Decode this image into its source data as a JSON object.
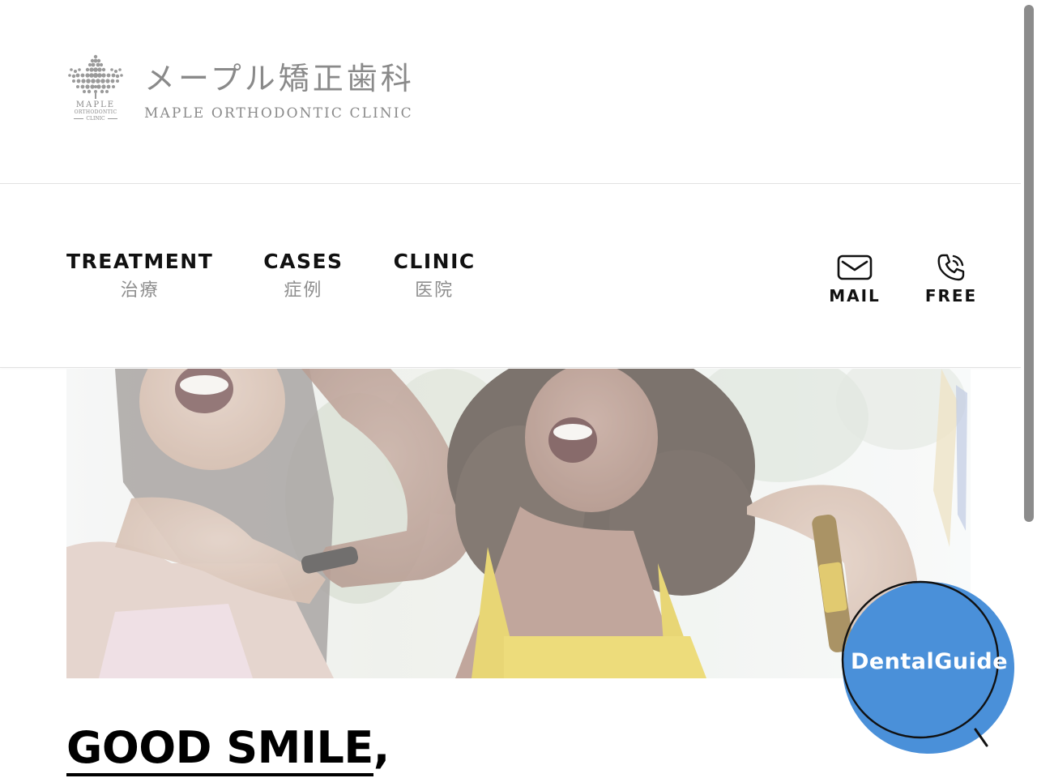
{
  "brand": {
    "mark_line1": "MAPLE",
    "mark_line2": "ORTHODONTIC",
    "mark_line3": "CLINIC",
    "name_jp": "メープル矯正歯科",
    "name_en": "MAPLE ORTHODONTIC CLINIC"
  },
  "nav": {
    "items": [
      {
        "en": "TREATMENT",
        "jp": "治療"
      },
      {
        "en": "CASES",
        "jp": "症例"
      },
      {
        "en": "CLINIC",
        "jp": "医院"
      }
    ],
    "mail": {
      "label": "MAIL",
      "icon": "envelope-icon"
    },
    "free": {
      "label": "FREE",
      "icon": "phone-icon"
    }
  },
  "hero": {
    "headline": "GOOD SMILE",
    "headline_suffix": ","
  },
  "badge": {
    "label": "DentalGuide",
    "icon": "magnifier-icon",
    "color": "#4a90d9"
  },
  "colors": {
    "text": "#111111",
    "muted": "#8e8e8e",
    "accent": "#4a90d9"
  }
}
